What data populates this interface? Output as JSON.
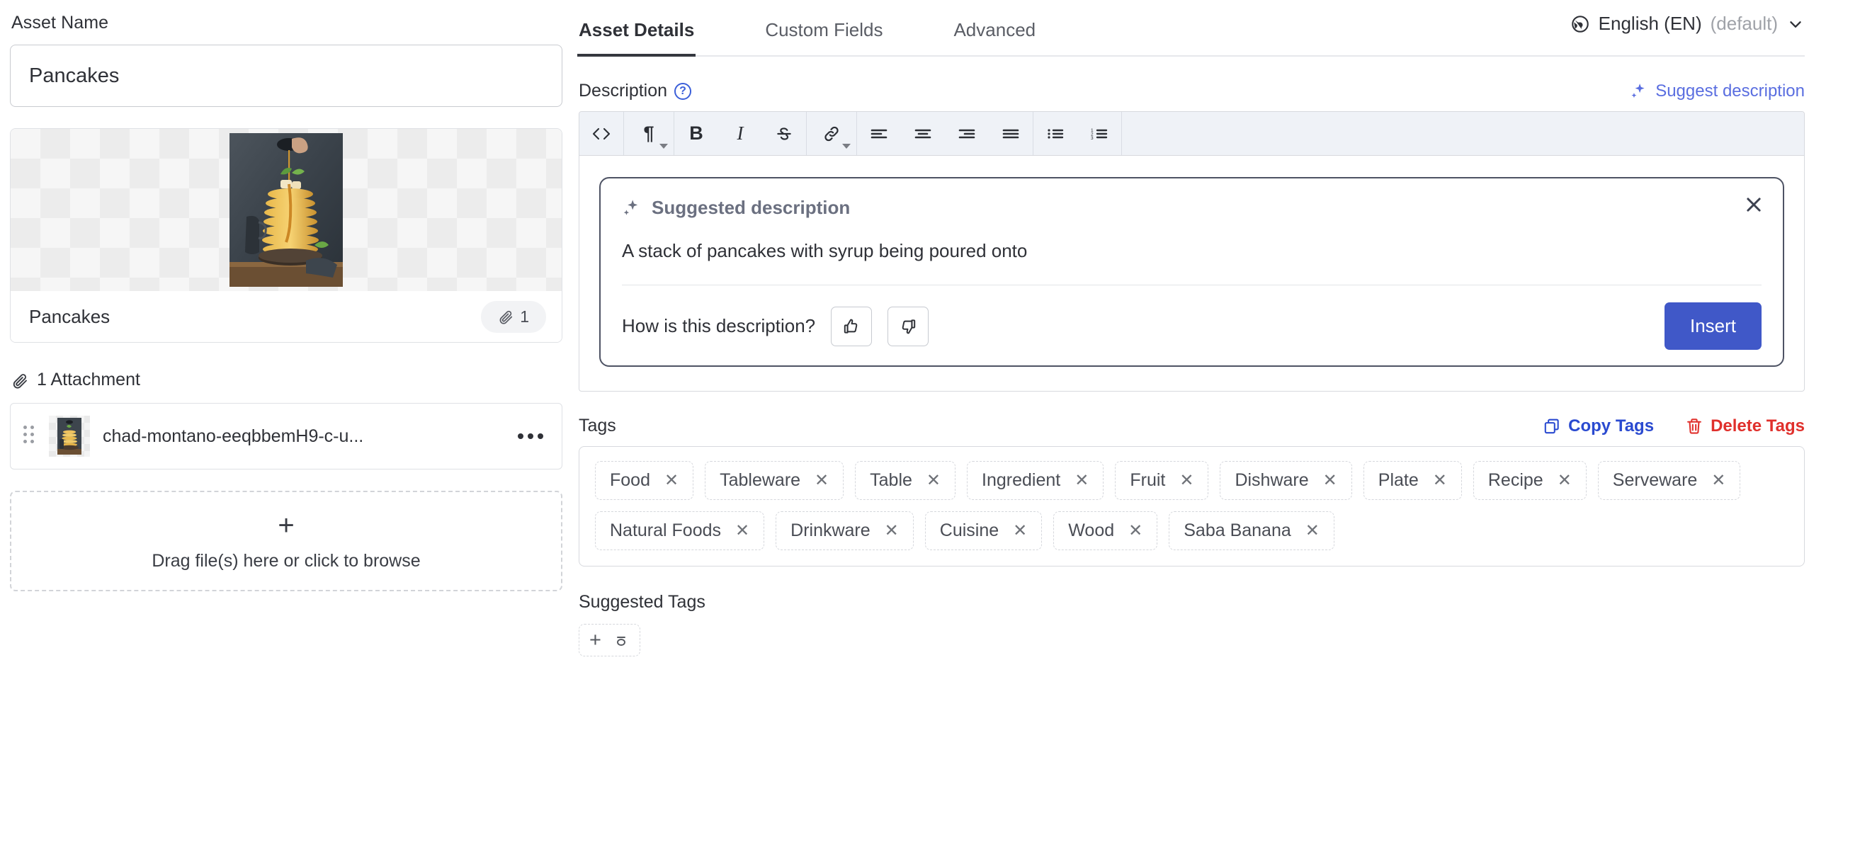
{
  "asset_name": {
    "label": "Asset Name",
    "value": "Pancakes",
    "placeholder": "Asset Name"
  },
  "preview": {
    "title": "Pancakes",
    "attachment_count": "1",
    "attachment_icon": "paperclip-icon"
  },
  "attachments": {
    "header": "1 Attachment",
    "header_icon": "paperclip-icon",
    "items": [
      {
        "filename": "chad-montano-eeqbbemH9-c-u...",
        "drag_handle_icon": "drag-handle-icon",
        "menu_icon": "more-horizontal-icon"
      }
    ]
  },
  "dropzone": {
    "plus_icon": "plus-icon",
    "text": "Drag file(s) here or click to browse"
  },
  "tabs": [
    {
      "label": "Asset Details",
      "active": true
    },
    {
      "label": "Custom Fields",
      "active": false
    },
    {
      "label": "Advanced",
      "active": false
    }
  ],
  "language": {
    "icon": "globe-icon",
    "name": "English (EN)",
    "default_suffix": "(default)",
    "chevron_icon": "chevron-down-icon"
  },
  "description": {
    "label": "Description",
    "help_icon": "help-circle-icon",
    "suggest_link": "Suggest description",
    "suggest_link_icon": "sparkle-icon",
    "toolbar": [
      {
        "name": "code-view-icon",
        "glyph": "<>",
        "caret": false
      },
      {
        "name": "paragraph-format-icon",
        "glyph": "¶",
        "caret": true
      },
      {
        "name": "bold-icon",
        "glyph": "B",
        "caret": false
      },
      {
        "name": "italic-icon",
        "glyph": "I",
        "caret": false
      },
      {
        "name": "strikethrough-icon",
        "glyph": "S",
        "caret": false
      },
      {
        "name": "link-icon",
        "glyph": "link",
        "caret": true
      },
      {
        "name": "align-left-icon",
        "glyph": "align-left",
        "caret": false
      },
      {
        "name": "align-center-icon",
        "glyph": "align-center",
        "caret": false
      },
      {
        "name": "align-right-icon",
        "glyph": "align-right",
        "caret": false
      },
      {
        "name": "align-justify-icon",
        "glyph": "align-justify",
        "caret": false
      },
      {
        "name": "bulleted-list-icon",
        "glyph": "ul",
        "caret": false
      },
      {
        "name": "numbered-list-icon",
        "glyph": "ol",
        "caret": false
      }
    ]
  },
  "suggested_description": {
    "header": "Suggested description",
    "header_icon": "sparkle-icon",
    "close_icon": "close-icon",
    "text": "A stack of pancakes with syrup being poured onto",
    "feedback_question": "How is this description?",
    "thumbs_up_icon": "thumbs-up-icon",
    "thumbs_down_icon": "thumbs-down-icon",
    "insert_label": "Insert"
  },
  "tags": {
    "label": "Tags",
    "copy_label": "Copy Tags",
    "copy_icon": "copy-icon",
    "delete_label": "Delete Tags",
    "delete_icon": "trash-icon",
    "items": [
      "Food",
      "Tableware",
      "Table",
      "Ingredient",
      "Fruit",
      "Dishware",
      "Plate",
      "Recipe",
      "Serveware",
      "Natural Foods",
      "Drinkware",
      "Cuisine",
      "Wood",
      "Saba Banana"
    ],
    "remove_glyph": "✕"
  },
  "suggested_tags": {
    "label": "Suggested Tags",
    "add_icon": "plus-icon",
    "loading_icon": "loading-icon"
  },
  "colors": {
    "accent_blue": "#4058c8",
    "link_blue": "#5a6ee0",
    "copy_blue": "#2a4ad0",
    "danger_red": "#e0302c",
    "toolbar_bg": "#eff2f7",
    "border": "#d7d9de"
  }
}
